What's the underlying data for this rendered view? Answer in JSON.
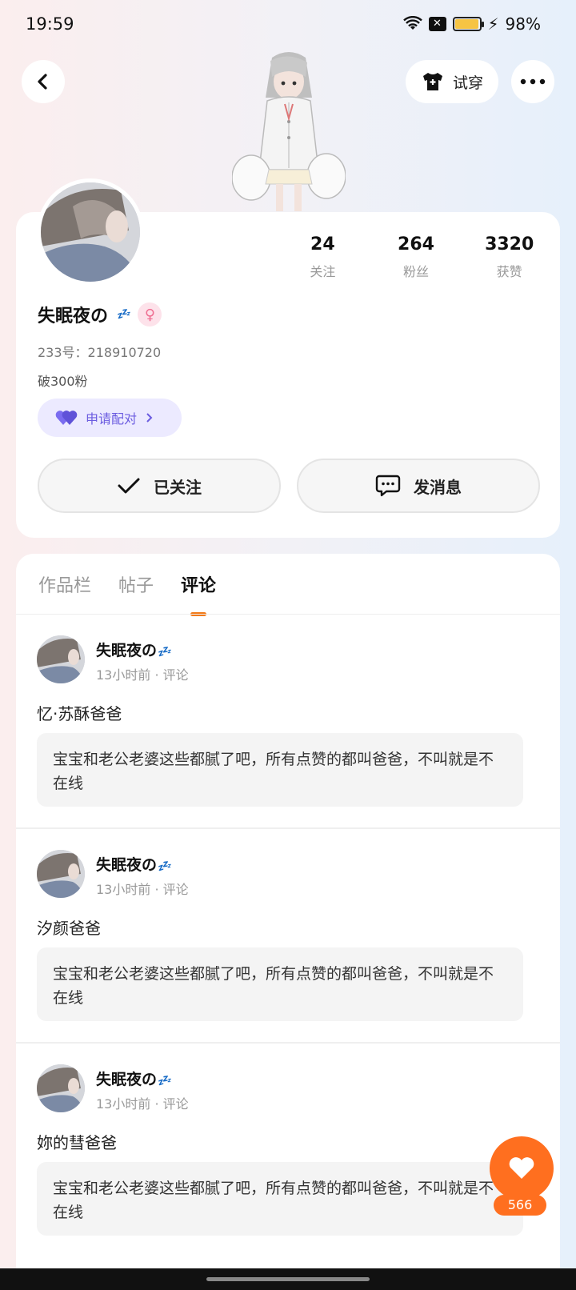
{
  "status": {
    "time": "19:59",
    "battery": "98%",
    "battery_level": 0.98
  },
  "header": {
    "try_on_label": "试穿"
  },
  "profile": {
    "name": "失眠夜の",
    "name_emoji": "💤",
    "gender_symbol": "♀",
    "id_line": "233号：218910720",
    "bio": "破300粉",
    "pair_label": "申请配对",
    "stats": [
      {
        "value": "24",
        "label": "关注"
      },
      {
        "value": "264",
        "label": "粉丝"
      },
      {
        "value": "3320",
        "label": "获赞"
      }
    ],
    "follow_label": "已关注",
    "message_label": "发消息"
  },
  "tabs": [
    {
      "label": "作品栏",
      "active": false
    },
    {
      "label": "帖子",
      "active": false
    },
    {
      "label": "评论",
      "active": true
    }
  ],
  "comments": [
    {
      "author": "失眠夜の",
      "meta": "13小时前 · 评论",
      "title": "忆·苏酥爸爸",
      "quote": "宝宝和老公老婆这些都腻了吧，所有点赞的都叫爸爸，不叫就是不在线"
    },
    {
      "author": "失眠夜の",
      "meta": "13小时前 · 评论",
      "title": "汐颜爸爸",
      "quote": "宝宝和老公老婆这些都腻了吧，所有点赞的都叫爸爸，不叫就是不在线"
    },
    {
      "author": "失眠夜の",
      "meta": "13小时前 · 评论",
      "title": "妳的彗爸爸",
      "quote": "宝宝和老公老婆这些都腻了吧，所有点赞的都叫爸爸，不叫就是不在线"
    }
  ],
  "like_fab": {
    "count": "566"
  },
  "colors": {
    "accent": "#ff6f1f",
    "pair_bg": "#eceaff",
    "pair_text": "#6b5ce0"
  }
}
